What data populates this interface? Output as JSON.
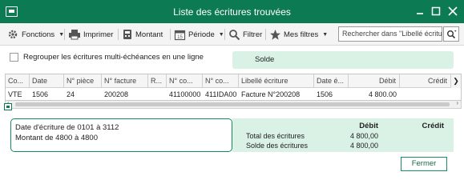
{
  "window": {
    "title": "Liste des écritures trouvées"
  },
  "toolbar": {
    "fonctions": "Fonctions",
    "imprimer": "Imprimer",
    "montant": "Montant",
    "periode": "Période",
    "filtrer": "Filtrer",
    "mes_filtres": "Mes filtres",
    "search_placeholder": "Rechercher dans \"Libellé écriture\""
  },
  "options": {
    "regroup_label": "Regrouper les écritures multi-échéances en une ligne",
    "regroup_checked": false,
    "solde_label": "Solde"
  },
  "grid": {
    "columns": [
      "Co...",
      "Date",
      "N° pièce",
      "N° facture",
      "R...",
      "N° co...",
      "N° co...",
      "Libellé écriture",
      "Date é...",
      "Débit",
      "Crédit"
    ],
    "rows": [
      {
        "code": "VTE",
        "date": "1506",
        "piece": "24",
        "facture": "200208",
        "r": "",
        "compte": "41100000",
        "compte_tiers": "411IDA00",
        "libelle": "Facture N°200208",
        "date_echeance": "1506",
        "debit": "4 800.00",
        "credit": ""
      }
    ]
  },
  "filter_summary": {
    "line1": "Date d'écriture de 0101 à 3112",
    "line2": "Montant de 4800 à 4800"
  },
  "totals": {
    "debit_header": "Débit",
    "credit_header": "Crédit",
    "total_label": "Total des écritures",
    "total_debit": "4 800,00",
    "solde_label": "Solde des écritures",
    "solde_debit": "4 800,00"
  },
  "footer": {
    "close_label": "Fermer"
  },
  "colors": {
    "title_bar": "#0c7a52",
    "accent_panel": "#daf1e5",
    "border_accent": "#138a5c"
  }
}
